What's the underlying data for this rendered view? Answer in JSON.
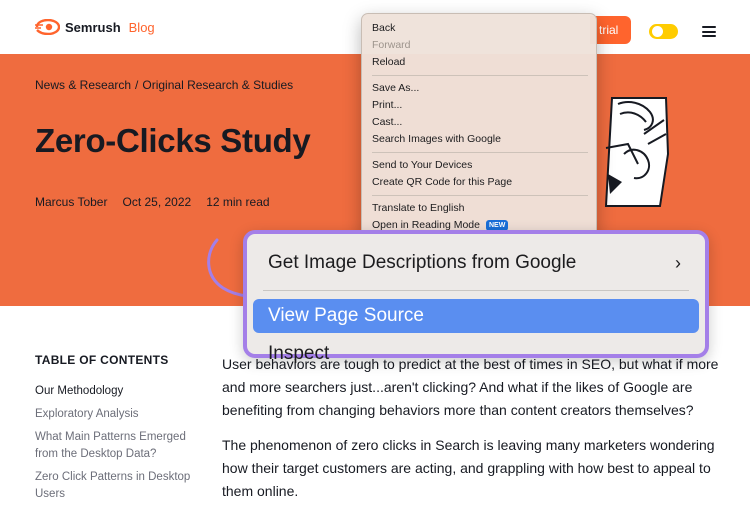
{
  "header": {
    "brand": "Semrush",
    "brand_suffix": "Blog",
    "trial_label": "trial",
    "accent": "#ff642d",
    "toggle_color": "#ffcc00"
  },
  "hero": {
    "background": "#ef6c3f",
    "breadcrumbs": [
      "News & Research",
      "Original Research & Studies"
    ],
    "title": "Zero-Clicks Study",
    "author": "Marcus Tober",
    "date": "Oct 25, 2022",
    "read_time": "12 min read"
  },
  "toc": {
    "title": "TABLE OF CONTENTS",
    "items": [
      "Our Methodology",
      "Exploratory Analysis",
      "What Main Patterns Emerged from the Desktop Data?",
      "Zero Click Patterns in Desktop Users"
    ]
  },
  "article": {
    "paragraphs": [
      "User behaviors are tough to predict at the best of times in SEO, but what if more and more searchers just...aren't clicking? And what if the likes of Google are benefiting from changing behaviors more than content creators themselves?",
      "The phenomenon of zero clicks in Search is leaving many marketers wondering how their target customers are acting, and grappling with how best to appeal to them online."
    ]
  },
  "context_menu": {
    "groups": [
      [
        {
          "label": "Back",
          "disabled": false
        },
        {
          "label": "Forward",
          "disabled": true
        },
        {
          "label": "Reload",
          "disabled": false
        }
      ],
      [
        {
          "label": "Save As...",
          "disabled": false
        },
        {
          "label": "Print...",
          "disabled": false
        },
        {
          "label": "Cast...",
          "disabled": false
        },
        {
          "label": "Search Images with Google",
          "disabled": false
        }
      ],
      [
        {
          "label": "Send to Your Devices",
          "disabled": false
        },
        {
          "label": "Create QR Code for this Page",
          "disabled": false
        }
      ],
      [
        {
          "label": "Translate to English",
          "disabled": false
        },
        {
          "label": "Open in Reading Mode",
          "disabled": false,
          "badge": "NEW"
        }
      ]
    ]
  },
  "zoom_menu": {
    "border_color": "#a47fe8",
    "highlight_color": "#5a8ef0",
    "image_descriptions_label": "Get Image Descriptions from Google",
    "view_source_label": "View Page Source",
    "inspect_label": "Inspect"
  }
}
